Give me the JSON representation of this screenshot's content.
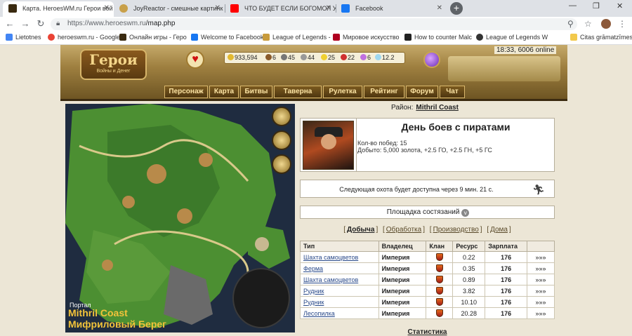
{
  "browser": {
    "tabs": [
      {
        "title": "Карта. HeroesWM.ru Герои вой",
        "active": true
      },
      {
        "title": "JoyReactor - смешные картинк"
      },
      {
        "title": "ЧТО БУДЕТ ЕСЛИ БОГОМОЛ УБ"
      },
      {
        "title": "Facebook"
      }
    ],
    "new_tab": "+",
    "minimize": "—",
    "maximize": "❐",
    "close": "✕",
    "url_domain": "https://www.heroeswm.ru",
    "url_path": "/map.php",
    "bookmarks": [
      "Lietotnes",
      "heroeswm.ru - Google",
      "Онлайн игры - Геро",
      "Welcome to Facebook",
      "League of Legends -",
      "Мировое искусство",
      "How to counter Malc",
      "League of Legends W",
      "Citas grāmatzīmes"
    ]
  },
  "game": {
    "logo_title": "Герои",
    "logo_subtitle": "Войны и Денег",
    "resources": [
      "933,594",
      "6",
      "45",
      "44",
      "25",
      "22",
      "6",
      "12.2"
    ],
    "time": "18:33, 6006 online",
    "menu": [
      "Персонаж",
      "Карта",
      "Битвы",
      "Таверна",
      "Рулетка",
      "Рейтинг",
      "Форум",
      "Чат"
    ]
  },
  "map": {
    "portal_label": "Портал",
    "region_en": "Mithril Coast",
    "region_ru": "Мифриловый Берег"
  },
  "panel": {
    "district_label": "Район:",
    "district_value": "Mithril Coast",
    "event_title": "День боев с пиратами",
    "event_wins": "Кол-во побед: 15",
    "event_reward": "Добыто: 5,000 золота, +2.5 ГО, +2.5 ГН, +5 ГС",
    "hunt_text": "Следующая охота будет доступна через 9 мин. 21 с.",
    "arena_text": "Площадка состязаний",
    "filters": [
      "Добыча",
      "Обработка",
      "Производство",
      "Дома"
    ],
    "table_headers": [
      "Тип",
      "Владелец",
      "Клан",
      "Ресурс",
      "Зарплата",
      ""
    ],
    "rows": [
      {
        "type": "Шахта самоцветов",
        "owner": "Империя",
        "resource": "0.22",
        "wage": "176",
        "action": "»»»"
      },
      {
        "type": "Ферма",
        "owner": "Империя",
        "resource": "0.35",
        "wage": "176",
        "action": "»»»"
      },
      {
        "type": "Шахта самоцветов",
        "owner": "Империя",
        "resource": "0.89",
        "wage": "176",
        "action": "»»»"
      },
      {
        "type": "Рудник",
        "owner": "Империя",
        "resource": "3.82",
        "wage": "176",
        "action": "»»»"
      },
      {
        "type": "Рудник",
        "owner": "Империя",
        "resource": "10.10",
        "wage": "176",
        "action": "»»»"
      },
      {
        "type": "Лесопилка",
        "owner": "Империя",
        "resource": "20.28",
        "wage": "176",
        "action": "»»»"
      }
    ],
    "stats_link": "Статистика"
  }
}
